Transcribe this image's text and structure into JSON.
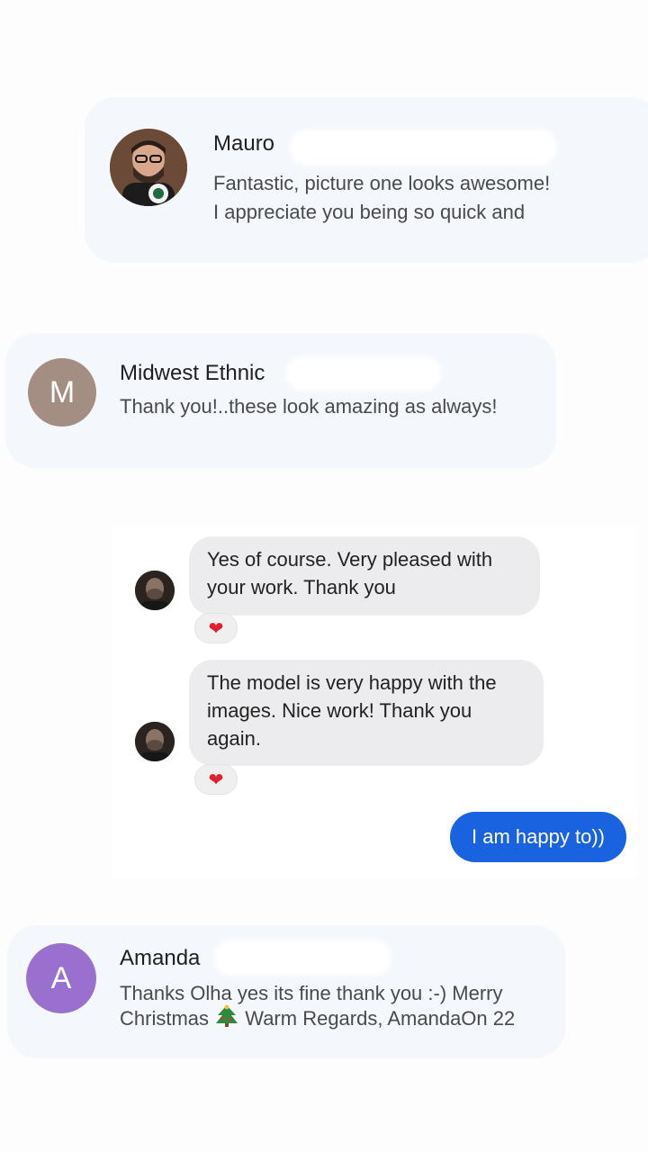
{
  "conversations": [
    {
      "name": "Mauro",
      "snippet_line1": "Fantastic, picture one looks awesome!",
      "snippet_line2": "I appreciate you being so quick and"
    },
    {
      "name": "Midwest Ethnic",
      "avatar_letter": "M",
      "snippet": "Thank you!..these look amazing as always!"
    },
    {
      "name": "Amanda",
      "avatar_letter": "A",
      "snippet_line1": "Thanks Olha yes its fine thank you :-) Merry",
      "snippet_line2_before": "Christmas",
      "snippet_line2_after": " Warm Regards, AmandaOn 22"
    }
  ],
  "chat": {
    "messages_in": [
      {
        "line1": "Yes of course. Very pleased with",
        "line2": "your work. Thank you",
        "reaction": "❤"
      },
      {
        "line1": "The model is very happy with the",
        "line2": "images. Nice work! Thank you",
        "line3": "again.",
        "reaction": "❤"
      }
    ],
    "message_out": "I am happy to))"
  },
  "colors": {
    "card_bg": "#f4f7fc",
    "accent_blue": "#1a63e0",
    "avatar_m": "#a48d82",
    "avatar_a": "#9a70cf",
    "heart": "#e02030"
  },
  "icons": [
    "person-photo-avatar",
    "christmas-tree-emoji",
    "heart-reaction-icon"
  ]
}
